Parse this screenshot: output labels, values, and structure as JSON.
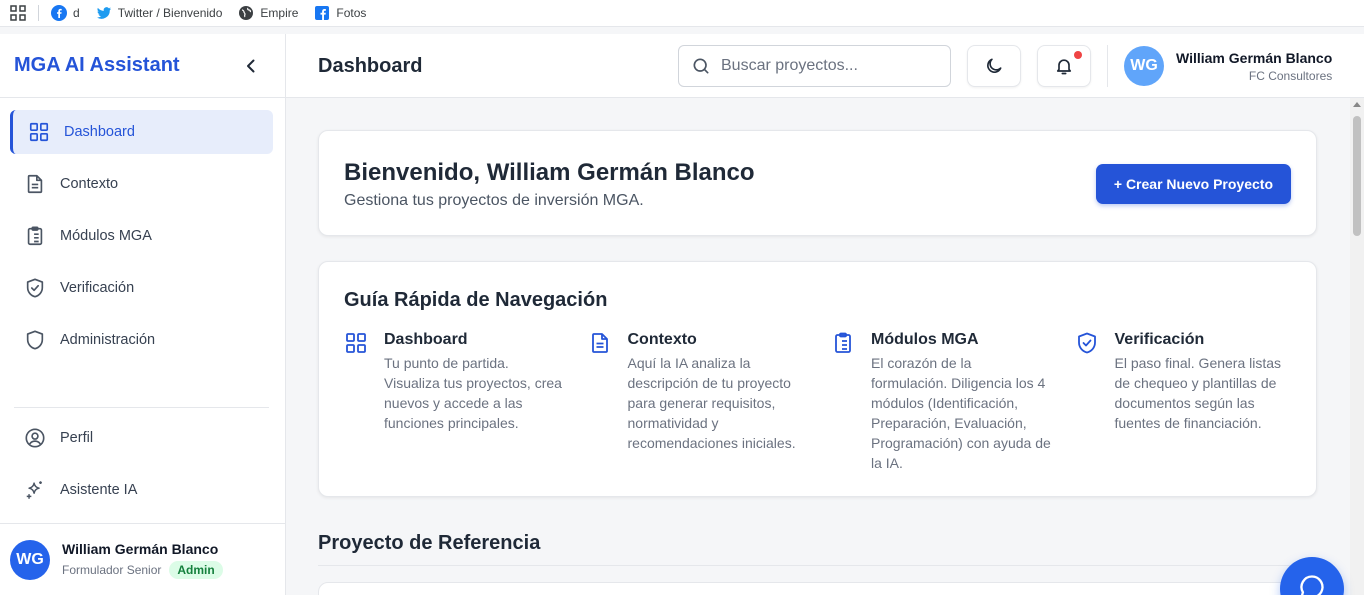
{
  "bookmarks": {
    "items": [
      {
        "label": "d",
        "icon": "facebook-icon"
      },
      {
        "label": "Twitter / Bienvenido",
        "icon": "twitter-icon"
      },
      {
        "label": "Empire",
        "icon": "globe-icon"
      },
      {
        "label": "Fotos",
        "icon": "facebook-square-icon"
      }
    ]
  },
  "sidebar": {
    "title": "MGA AI Assistant",
    "items": [
      {
        "label": "Dashboard",
        "icon": "grid-icon",
        "active": true
      },
      {
        "label": "Contexto",
        "icon": "document-icon"
      },
      {
        "label": "Módulos MGA",
        "icon": "clipboard-list-icon"
      },
      {
        "label": "Verificación",
        "icon": "shield-check-icon"
      },
      {
        "label": "Administración",
        "icon": "shield-icon"
      }
    ],
    "bottom_items": [
      {
        "label": "Perfil",
        "icon": "user-circle-icon"
      },
      {
        "label": "Asistente IA",
        "icon": "sparkles-icon"
      }
    ],
    "user": {
      "initials": "WG",
      "name": "William Germán Blanco",
      "role": "Formulador Senior",
      "badge": "Admin"
    }
  },
  "header": {
    "title": "Dashboard",
    "search_placeholder": "Buscar proyectos...",
    "user": {
      "initials": "WG",
      "name": "William Germán Blanco",
      "org": "FC Consultores"
    }
  },
  "welcome": {
    "title": "Bienvenido, William Germán Blanco",
    "subtitle": "Gestiona tus proyectos de inversión MGA.",
    "create_button": "+ Crear Nuevo Proyecto"
  },
  "guide": {
    "title": "Guía Rápida de Navegación",
    "items": [
      {
        "title": "Dashboard",
        "icon": "grid-icon",
        "desc": "Tu punto de partida. Visualiza tus proyectos, crea nuevos y accede a las funciones principales."
      },
      {
        "title": "Contexto",
        "icon": "document-icon",
        "desc": "Aquí la IA analiza la descripción de tu proyecto para generar requisitos, normatividad y recomendaciones iniciales."
      },
      {
        "title": "Módulos MGA",
        "icon": "clipboard-list-icon",
        "desc": "El corazón de la formulación. Diligencia los 4 módulos (Identificación, Preparación, Evaluación, Programación) con ayuda de la IA."
      },
      {
        "title": "Verificación",
        "icon": "shield-check-icon",
        "desc": "El paso final. Genera listas de chequeo y plantillas de documentos según las fuentes de financiación."
      }
    ]
  },
  "reference": {
    "title": "Proyecto de Referencia"
  },
  "colors": {
    "accent": "#2554d8",
    "notification": "#ef4444",
    "badge_bg": "#dcfce7",
    "badge_text": "#15803d"
  }
}
